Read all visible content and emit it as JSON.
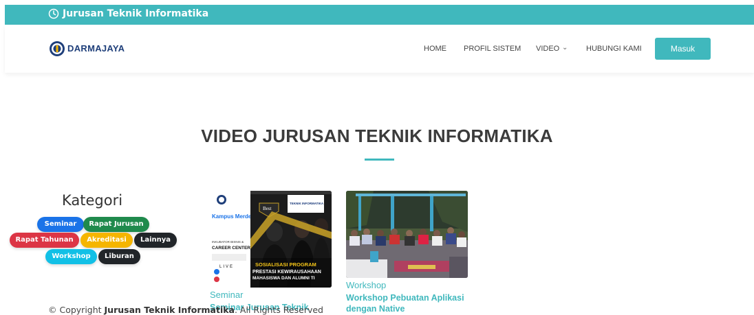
{
  "topbar": {
    "title": "Jurusan Teknik Informatika",
    "icon": "clock-icon",
    "bg": "#40b8bd"
  },
  "navbar": {
    "logo_text": "DARMAJAYA",
    "items": [
      "HOME",
      "PROFIL SISTEM",
      "VIDEO",
      "HUBUNGI KAMI"
    ],
    "login_label": "Masuk"
  },
  "main": {
    "title": "VIDEO JURUSAN TEKNIK INFORMATIKA",
    "kategori": {
      "title": "Kategori",
      "tags": [
        {
          "label": "Seminar",
          "color": "#1a73e8"
        },
        {
          "label": "Rapat Jurusan",
          "color": "#1f8a4c"
        },
        {
          "label": "Rapat Tahunan",
          "color": "#dc3545"
        },
        {
          "label": "Akreditasi",
          "color": "#f5b500"
        },
        {
          "label": "Lainnya",
          "color": "#212529"
        },
        {
          "label": "Workshop",
          "color": "#12c0e6"
        },
        {
          "label": "Liburan",
          "color": "#212529"
        }
      ]
    },
    "videos": [
      {
        "category": "Seminar",
        "title": "Seminar Jurusan Teknik",
        "poster": {
          "brand": "Kampus Merdeka",
          "lines": [
            "Best",
            "TEKNIK INFORMATIKA",
            "INKUBATOR BISNIS &",
            "CAREER CENTER",
            "LIVE",
            "SOSIALISASI PROGRAM",
            "PRESTASI KEWIRAUSAHAAN",
            "MAHASISWA DAN ALUMNI TI"
          ]
        }
      },
      {
        "category": "Workshop",
        "title": "Workshop Pebuatan Aplikasi dengan Native"
      }
    ]
  },
  "footer": {
    "prefix": "© Copyright ",
    "org": "Jurusan Teknik Informatika",
    "suffix": ". All Rights Reserved"
  },
  "colors": {
    "accent": "#40b8bd"
  }
}
